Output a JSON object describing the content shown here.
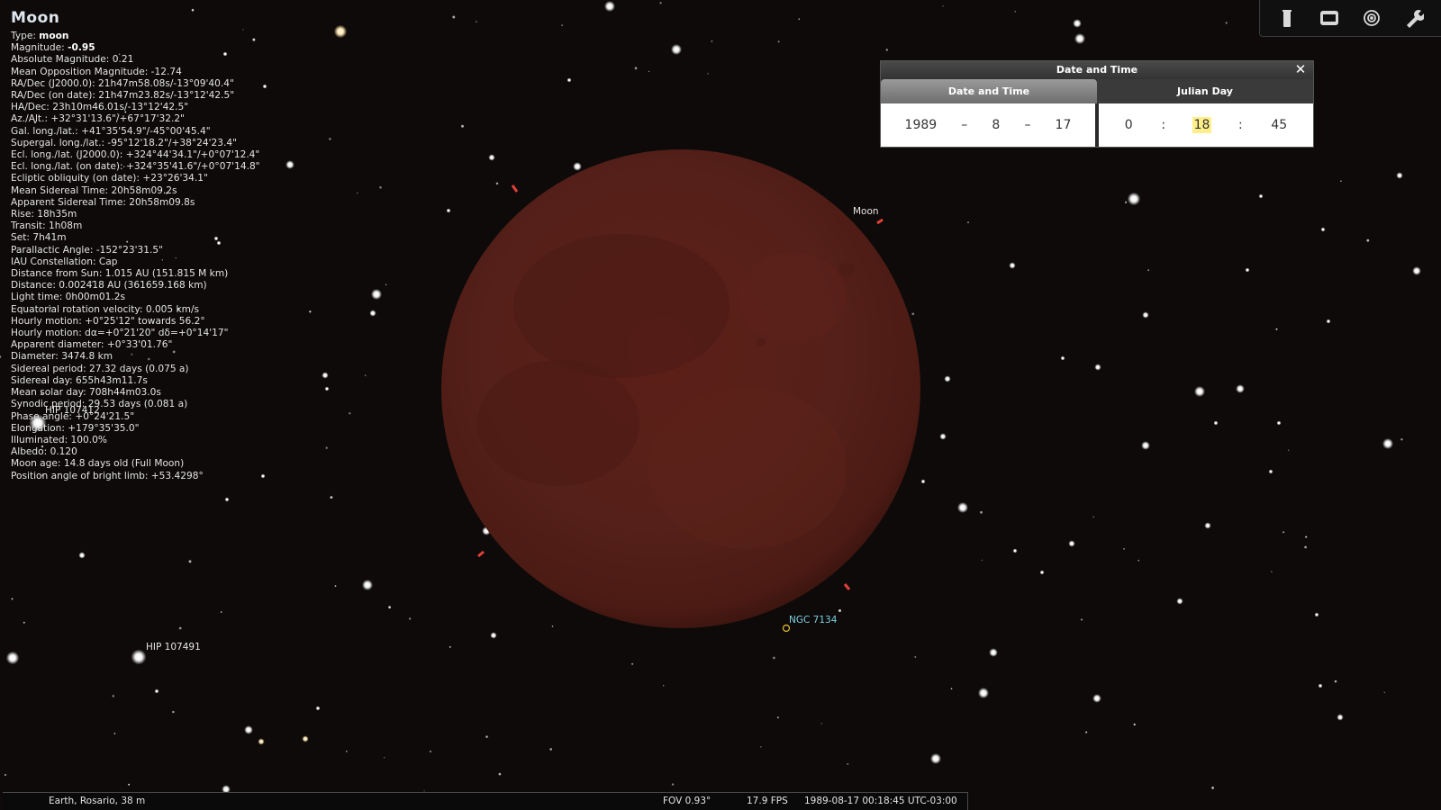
{
  "info": {
    "title": "Moon",
    "lines": [
      {
        "label": "Type: ",
        "value": "moon"
      },
      {
        "label": "Magnitude: ",
        "value": "-0.95"
      },
      {
        "label": "Absolute Magnitude: 0.21"
      },
      {
        "label": "Mean Opposition Magnitude: -12.74"
      },
      {
        "label": "RA/Dec (J2000.0): 21h47m58.08s/-13°09'40.4\""
      },
      {
        "label": "RA/Dec (on date): 21h47m23.82s/-13°12'42.5\""
      },
      {
        "label": "HA/Dec: 23h10m46.01s/-13°12'42.5\""
      },
      {
        "label": "Az./Alt.: +32°31'13.6\"/+67°17'32.2\""
      },
      {
        "label": "Gal. long./lat.: +41°35'54.9\"/-45°00'45.4\""
      },
      {
        "label": "Supergal. long./lat.: -95°12'18.2\"/+38°24'23.4\""
      },
      {
        "label": "Ecl. long./lat. (J2000.0): +324°44'34.1\"/+0°07'12.4\""
      },
      {
        "label": "Ecl. long./lat. (on date): +324°35'41.6\"/+0°07'14.8\""
      },
      {
        "label": "Ecliptic obliquity (on date): +23°26'34.1\""
      },
      {
        "label": "Mean Sidereal Time: 20h58m09.2s"
      },
      {
        "label": "Apparent Sidereal Time: 20h58m09.8s"
      },
      {
        "label": "Rise: 18h35m"
      },
      {
        "label": "Transit: 1h08m"
      },
      {
        "label": "Set: 7h41m"
      },
      {
        "label": "Parallactic Angle: -152°23'31.5\""
      },
      {
        "label": "IAU Constellation: Cap"
      },
      {
        "label": "Distance from Sun: 1.015 AU (151.815 M km)"
      },
      {
        "label": "Distance: 0.002418 AU (361659.168 km)"
      },
      {
        "label": "Light time: 0h00m01.2s"
      },
      {
        "label": "Equatorial rotation velocity: 0.005 km/s"
      },
      {
        "label": "Hourly motion: +0°25'12\" towards 56.2°"
      },
      {
        "label": "Hourly motion: dα=+0°21'20\" dδ=+0°14'17\""
      },
      {
        "label": "Apparent diameter: +0°33'01.76\""
      },
      {
        "label": "Diameter: 3474.8 km"
      },
      {
        "label": "Sidereal period: 27.32 days (0.075 a)"
      },
      {
        "label": "Sidereal day: 655h43m11.7s"
      },
      {
        "label": "Mean solar day: 708h44m03.0s"
      },
      {
        "label": "Synodic period: 29.53 days (0.081 a)"
      },
      {
        "label": "Phase angle: +0°24'21.5\""
      },
      {
        "label": "Elongation: +179°35'35.0\""
      },
      {
        "label": "Illuminated: 100.0%"
      },
      {
        "label": "Albedo: 0.120"
      },
      {
        "label": "Moon age: 14.8 days old (Full Moon)"
      },
      {
        "label": "Position angle of bright limb: +53.4298°"
      }
    ]
  },
  "sky_labels": {
    "moon": "Moon",
    "ngc": "NGC 7134",
    "hip1": "HIP 107412",
    "hip2": "HIP 107491"
  },
  "toolbar": {
    "icons": [
      "flask-icon",
      "window-icon",
      "target-icon",
      "wrench-icon"
    ]
  },
  "dialog": {
    "title": "Date and Time",
    "close": "✕",
    "tabs": [
      "Date and Time",
      "Julian Day"
    ],
    "year": "1989",
    "month": "8",
    "day": "17",
    "hour": "0",
    "minute": "18",
    "second": "45",
    "date_sep": "–",
    "time_sep": ":"
  },
  "status": {
    "location": "Earth, Rosario, 38 m",
    "fov": "FOV 0.93°",
    "fps": "17.9 FPS",
    "datetime": "1989-08-17 00:18:45 UTC-03:00"
  },
  "colors": {
    "sky": "#0d0a09",
    "moon_base": "#5a1f17",
    "moon_edge": "#4a1812",
    "highlight": "#ffef8a",
    "nebula_label": "#7fd0e0"
  }
}
